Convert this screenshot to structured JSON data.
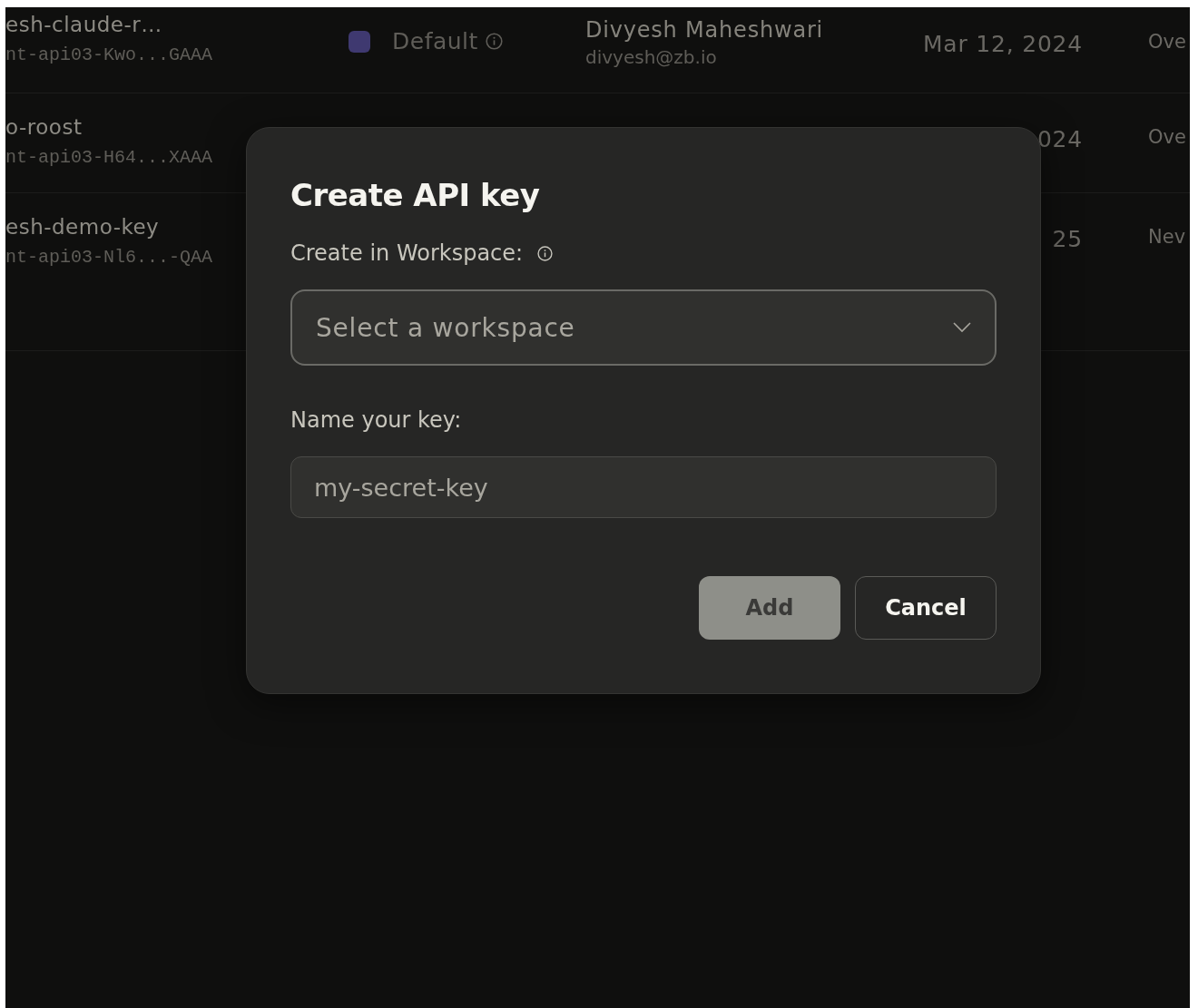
{
  "table": {
    "rows": [
      {
        "name": "esh-claude-r…",
        "key": "nt-api03-Kwo...GAAA",
        "workspace": {
          "label": "Default",
          "color": "#3f3970"
        },
        "owner": {
          "name": "Divyesh Maheshwari",
          "email": "divyesh@zb.io"
        },
        "date": "Mar 12, 2024",
        "column_5": "Ove"
      },
      {
        "name": "o-roost",
        "key": "nt-api03-H64...XAAA",
        "date": "024",
        "column_5": "Ove"
      },
      {
        "name": "esh-demo-key",
        "key": "nt-api03-Nl6...-QAA",
        "date": "25",
        "column_5": "Nev"
      }
    ]
  },
  "dialog": {
    "title": "Create API key",
    "workspace_label": "Create in Workspace:",
    "workspace_select": {
      "placeholder": "Select a workspace"
    },
    "name_label": "Name your key:",
    "name_field": {
      "placeholder": "my-secret-key"
    },
    "buttons": [
      {
        "label": "Add",
        "kind": "primary",
        "disabled": true
      },
      {
        "label": "Cancel",
        "kind": "secondary",
        "disabled": false
      }
    ]
  }
}
